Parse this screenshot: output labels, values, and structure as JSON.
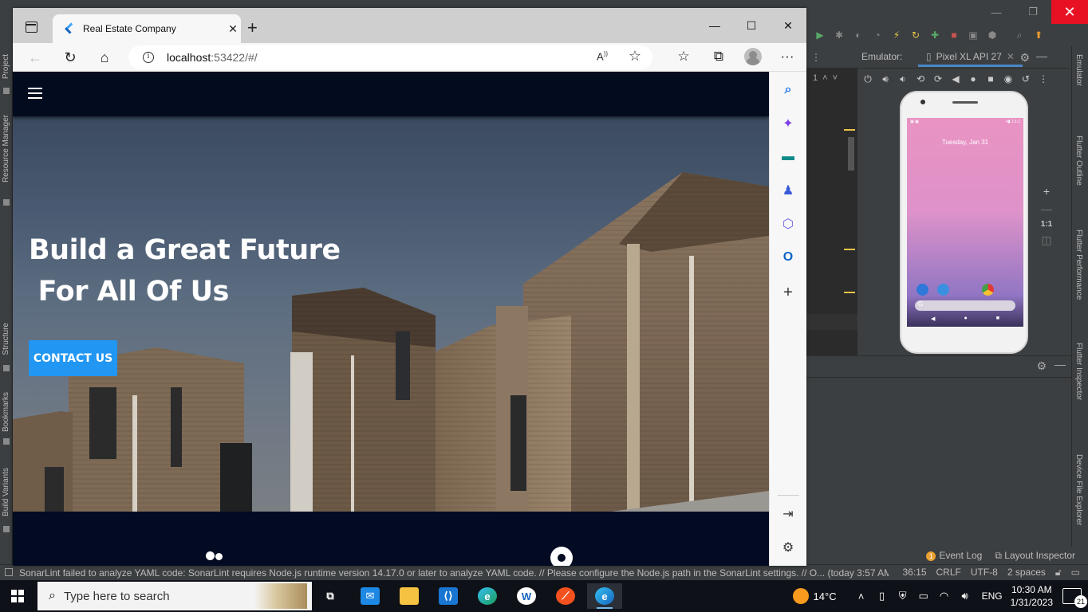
{
  "ide": {
    "emulator_label": "Emulator:",
    "emulator_tab": "Pixel XL API 27",
    "phone_date": "Tuesday, Jan 31",
    "gutter_number": "1",
    "zoom_ratio": "1:1",
    "left_panels": [
      "Project",
      "Resource Manager",
      "Structure",
      "Bookmarks",
      "Build Variants"
    ],
    "right_panels": [
      "Emulator",
      "Flutter Outline",
      "Flutter Performance",
      "Flutter Inspector",
      "Device File Explorer"
    ],
    "event_log": "Event Log",
    "layout_inspector": "Layout Inspector",
    "status_message": "SonarLint failed to analyze YAML code: SonarLint requires Node.js runtime version 14.17.0 or later to analyze YAML code. // Please configure the Node.js path in the SonarLint settings. // O... (today 3:57 AM)",
    "cursor_pos": "36:15",
    "line_sep": "CRLF",
    "encoding": "UTF-8",
    "indent": "2 spaces"
  },
  "browser": {
    "tab_title": "Real Estate Company",
    "url_host": "localhost",
    "url_rest": ":53422/#/",
    "read_aloud": "A",
    "more": "···"
  },
  "site": {
    "hero_title": "Build a Great Future\n For All Of Us",
    "contact_button": "CONTACT US"
  },
  "taskbar": {
    "search_placeholder": "Type here to search",
    "weather": "14°C",
    "language": "ENG",
    "time": "10:30 AM",
    "date": "1/31/2023",
    "notifications": "21"
  },
  "colors": {
    "content_bg": "#010a1e",
    "button": "#2196f3",
    "ide_bg": "#3c3f41",
    "taskbar": "#0e1117"
  }
}
